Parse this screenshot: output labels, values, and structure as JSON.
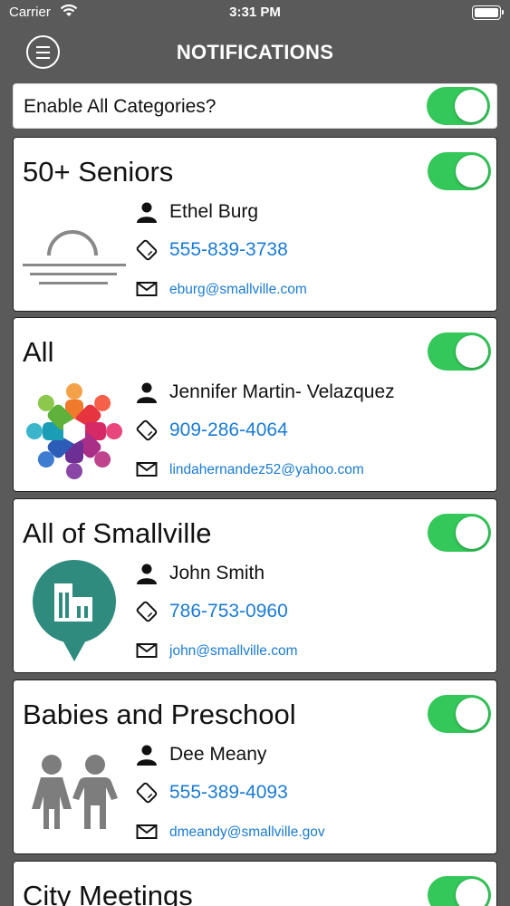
{
  "status_bar": {
    "carrier": "Carrier",
    "time": "3:31 PM"
  },
  "nav": {
    "title": "NOTIFICATIONS",
    "menu_icon": "hamburger-icon"
  },
  "enable_all": {
    "label": "Enable All Categories?",
    "enabled": true
  },
  "colors": {
    "toggle_on": "#34c759",
    "link": "#1a7bd5",
    "background": "#5a5a5a"
  },
  "categories": [
    {
      "title": "50+ Seniors",
      "enabled": true,
      "image": "sunset-icon",
      "contact": {
        "name": "Ethel Burg",
        "phone": "555-839-3738",
        "email": "eburg@smallville.com"
      }
    },
    {
      "title": "All",
      "enabled": true,
      "image": "people-circle-icon",
      "contact": {
        "name": "Jennifer Martin- Velazquez",
        "phone": "909-286-4064",
        "email": "lindahernandez52@yahoo.com"
      }
    },
    {
      "title": "All of Smallville",
      "enabled": true,
      "image": "city-pin-icon",
      "contact": {
        "name": "John Smith",
        "phone": "786-753-0960",
        "email": "john@smallville.com"
      }
    },
    {
      "title": "Babies and Preschool",
      "enabled": true,
      "image": "children-icon",
      "contact": {
        "name": "Dee Meany",
        "phone": "555-389-4093",
        "email": "dmeandy@smallville.gov"
      }
    },
    {
      "title": "City Meetings",
      "enabled": true
    }
  ]
}
